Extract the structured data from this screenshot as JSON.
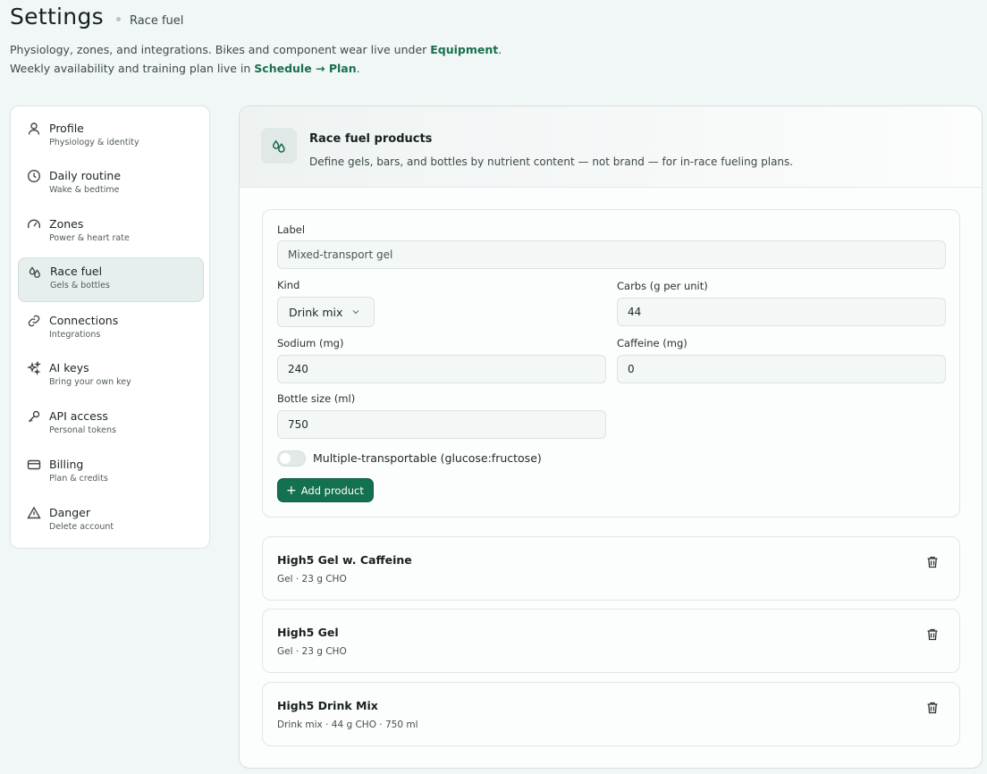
{
  "header": {
    "title": "Settings",
    "crumb": "Race fuel",
    "subtitle_part1": "Physiology, zones, and integrations. Bikes and component wear live under ",
    "link_equipment": "Equipment",
    "subtitle_part2": ". Weekly availability and training plan live in ",
    "link_plan": "Schedule → Plan",
    "subtitle_part3": "."
  },
  "sidebar": {
    "items": [
      {
        "label": "Profile",
        "sub": "Physiology & identity",
        "icon": "person-icon"
      },
      {
        "label": "Daily routine",
        "sub": "Wake & bedtime",
        "icon": "clock-icon"
      },
      {
        "label": "Zones",
        "sub": "Power & heart rate",
        "icon": "gauge-icon"
      },
      {
        "label": "Race fuel",
        "sub": "Gels & bottles",
        "icon": "droplets-icon",
        "active": true
      },
      {
        "label": "Connections",
        "sub": "Integrations",
        "icon": "link-icon"
      },
      {
        "label": "AI keys",
        "sub": "Bring your own key",
        "icon": "sparkles-icon"
      },
      {
        "label": "API access",
        "sub": "Personal tokens",
        "icon": "key-icon"
      },
      {
        "label": "Billing",
        "sub": "Plan & credits",
        "icon": "credit-card-icon"
      },
      {
        "label": "Danger",
        "sub": "Delete account",
        "icon": "warning-icon"
      }
    ]
  },
  "panel": {
    "title": "Race fuel products",
    "description": "Define gels, bars, and bottles by nutrient content — not brand — for in-race fueling plans.",
    "form": {
      "label_label": "Label",
      "label_placeholder": "Mixed-transport gel",
      "kind_label": "Kind",
      "kind_value": "Drink mix",
      "carbs_label": "Carbs (g per unit)",
      "carbs_value": "44",
      "sodium_label": "Sodium (mg)",
      "sodium_value": "240",
      "caffeine_label": "Caffeine (mg)",
      "caffeine_value": "0",
      "bottle_label": "Bottle size (ml)",
      "bottle_value": "750",
      "toggle_label": "Multiple-transportable (glucose:fructose)",
      "toggle_on": false,
      "add_button": "Add product"
    },
    "products": [
      {
        "name": "High5 Gel w. Caffeine",
        "meta": "Gel · 23 g CHO"
      },
      {
        "name": "High5 Gel",
        "meta": "Gel · 23 g CHO"
      },
      {
        "name": "High5 Drink Mix",
        "meta": "Drink mix · 44 g CHO · 750 ml"
      }
    ]
  },
  "colors": {
    "accent": "#14714f",
    "background": "#f1f6f6",
    "active_nav": "#e6efed"
  }
}
